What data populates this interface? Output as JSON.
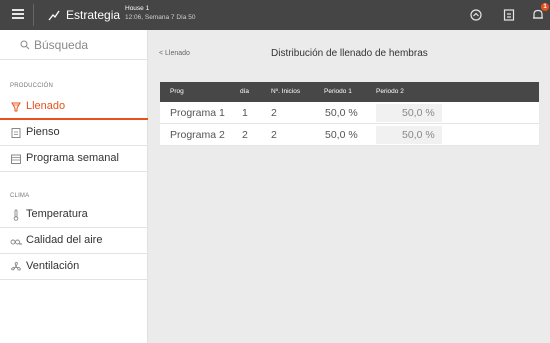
{
  "topbar": {
    "title": "Estrategia",
    "house": "House 1",
    "subtitle": "12:06, Semana 7 Día 50",
    "badge_count": "1"
  },
  "sidebar": {
    "search_placeholder": "Búsqueda",
    "sections": [
      {
        "label": "PRODUCCIÓN",
        "items": [
          {
            "label": "Llenado",
            "icon": "feeder-icon",
            "active": true
          },
          {
            "label": "Pienso",
            "icon": "feed-icon"
          },
          {
            "label": "Programa semanal",
            "icon": "calendar-icon"
          }
        ]
      },
      {
        "label": "CLIMA",
        "items": [
          {
            "label": "Temperatura",
            "icon": "thermometer-icon"
          },
          {
            "label": "Calidad del aire",
            "icon": "co2-icon"
          },
          {
            "label": "Ventilación",
            "icon": "fan-icon"
          }
        ]
      }
    ]
  },
  "content": {
    "breadcrumb": "< Llenado",
    "title": "Distribución de llenado de hembras",
    "table": {
      "headers": [
        "Prog",
        "día",
        "Nº. Inicios",
        "Periodo 1",
        "Periodo 2"
      ],
      "rows": [
        [
          "Programa 1",
          "1",
          "2",
          "50,0 %",
          "50,0 %"
        ],
        [
          "Programa 2",
          "2",
          "2",
          "50,0 %",
          "50,0 %"
        ]
      ]
    }
  },
  "colors": {
    "accent": "#e8511e",
    "topbar": "#454545",
    "table_header": "#474747"
  }
}
